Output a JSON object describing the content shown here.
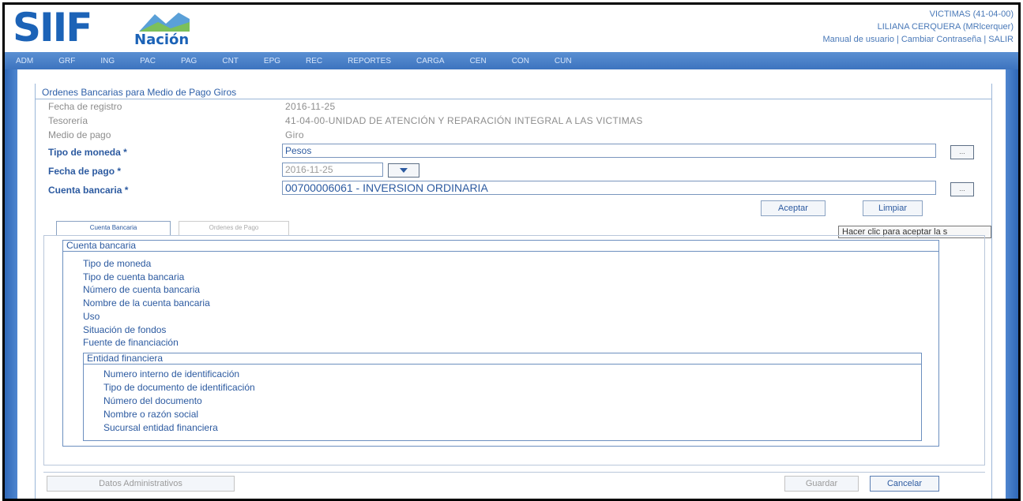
{
  "header": {
    "logo_text": "SIIF",
    "logo_subtext": "Nación",
    "entity": "VICTIMAS (41-04-00)",
    "user": "LILIANA CERQUERA (MRlcerquer)",
    "links": [
      "Manual de usuario",
      "Cambiar Contraseña",
      "SALIR"
    ]
  },
  "menu": [
    "ADM",
    "GRF",
    "ING",
    "PAC",
    "PAG",
    "CNT",
    "EPG",
    "REC",
    "REPORTES",
    "CARGA",
    "CEN",
    "CON",
    "CUN"
  ],
  "form": {
    "title": "Ordenes Bancarias para Medio de Pago Giros",
    "fecha_registro_label": "Fecha de registro",
    "fecha_registro_value": "2016-11-25",
    "tesoreria_label": "Tesorería",
    "tesoreria_value": "41-04-00-UNIDAD DE ATENCIÓN Y REPARACIÓN INTEGRAL A LAS VICTIMAS",
    "medio_pago_label": "Medio de pago",
    "medio_pago_value": "Giro",
    "tipo_moneda_label": "Tipo de moneda *",
    "tipo_moneda_value": "Pesos",
    "fecha_pago_label": "Fecha de pago *",
    "fecha_pago_value": "2016-11-25",
    "cuenta_bancaria_label": "Cuenta bancaria *",
    "cuenta_bancaria_value": "00700006061 - INVERSION ORDINARIA",
    "dots_label": "...",
    "aceptar_label": "Aceptar",
    "limpiar_label": "Limpiar",
    "tooltip": "Hacer clic para aceptar la s"
  },
  "tabs": [
    "Cuenta Bancaria",
    "Ordenes de Pago"
  ],
  "cuenta_section": {
    "legend": "Cuenta bancaria",
    "items": [
      "Tipo de moneda",
      "Tipo de cuenta bancaria",
      "Número de cuenta bancaria",
      "Nombre de la cuenta bancaria",
      "Uso",
      "Situación de fondos",
      "Fuente de financiación"
    ]
  },
  "entidad_section": {
    "legend": "Entidad financiera",
    "items": [
      "Numero interno de identificación",
      "Tipo de documento de identificación",
      "Número del documento",
      "Nombre o razón social",
      "Sucursal entidad financiera"
    ]
  },
  "footer": {
    "datos_admin": "Datos Administrativos",
    "guardar": "Guardar",
    "cancelar": "Cancelar"
  }
}
